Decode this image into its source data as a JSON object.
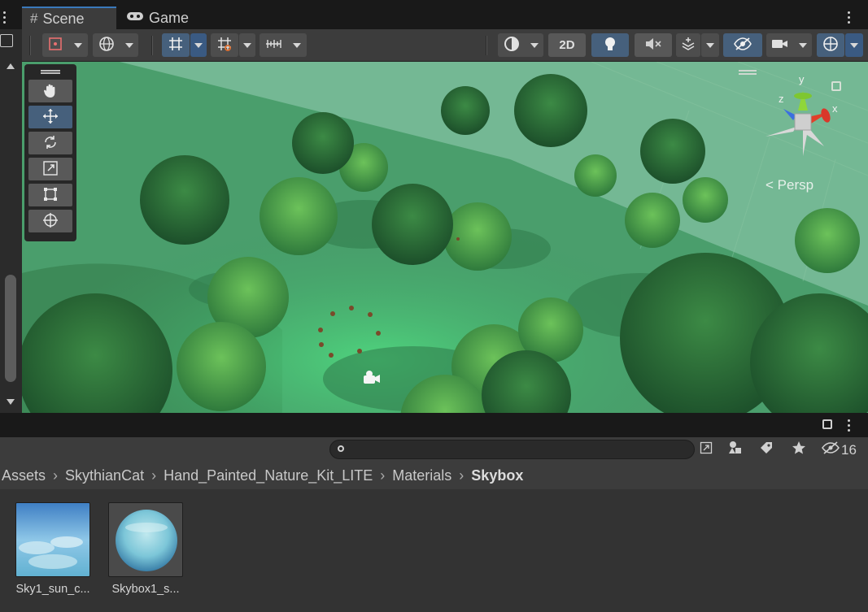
{
  "tabs": {
    "scene_label": "Scene",
    "game_label": "Game"
  },
  "scene_toolbar": {
    "mode_2d_label": "2D",
    "icons": [
      "draw-mode-icon",
      "global-icon",
      "grid-snap-icon",
      "increment-snap-icon",
      "ruler-icon",
      "shading-icon",
      "lighting-icon",
      "audio-mute-icon",
      "effects-icon",
      "visibility-icon",
      "camera-icon",
      "gizmos-icon"
    ]
  },
  "viewport": {
    "projection_label": "Persp",
    "gizmo_x": "x",
    "gizmo_y": "y",
    "gizmo_z": "z",
    "tools": [
      "hand-tool",
      "move-tool",
      "rotate-tool",
      "scale-tool",
      "rect-tool",
      "transform-tool"
    ],
    "active_tool": "move-tool"
  },
  "project": {
    "search_placeholder": "",
    "search_value": "",
    "hidden_packages_count": "16",
    "breadcrumb": [
      "Assets",
      "SkythianCat",
      "Hand_Painted_Nature_Kit_LITE",
      "Materials",
      "Skybox"
    ],
    "assets": [
      {
        "name": "Sky1_sun_c...",
        "type": "texture"
      },
      {
        "name": "Skybox1_s...",
        "type": "material"
      }
    ]
  },
  "colors": {
    "accent": "#3a79bb",
    "active_button": "#46607c",
    "panel": "#3c3c3c",
    "background": "#282828"
  }
}
